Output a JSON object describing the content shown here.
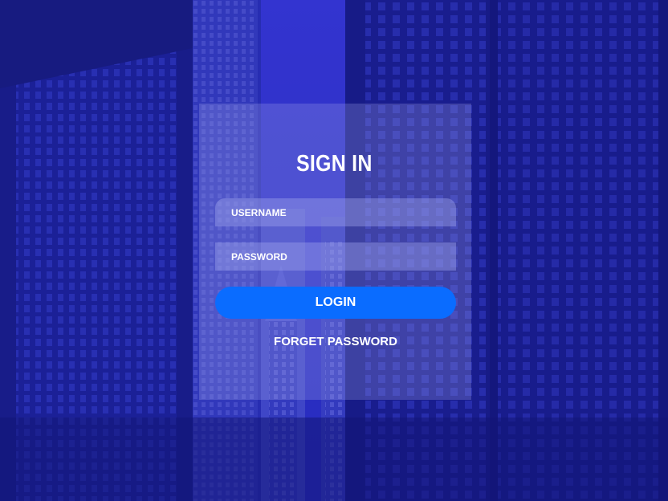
{
  "login_form": {
    "title": "SIGN IN",
    "username_placeholder": "USERNAME",
    "password_placeholder": "PASSWORD",
    "login_label": "LOGIN",
    "forget_label": "FORGET PASSWORD"
  },
  "colors": {
    "background_tint": "#1f23a8",
    "button": "#0a6cff",
    "text": "#ffffff"
  }
}
